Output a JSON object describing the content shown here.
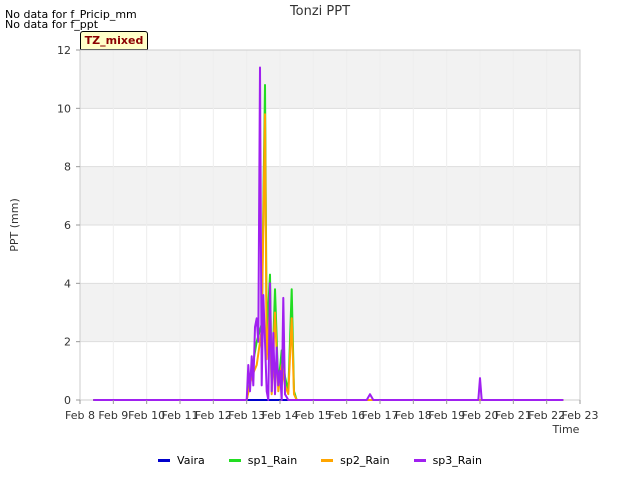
{
  "notes": [
    "No data for f_Pricip_mm",
    "No data for f_ppt"
  ],
  "tag_label": "TZ_mixed",
  "colors": {
    "Vaira": "#0000cc",
    "sp1_Rain": "#22dd22",
    "sp2_Rain": "#ffa500",
    "sp3_Rain": "#a020f0",
    "band": "#f2f2f2",
    "grid": "#dddddd"
  },
  "chart_data": {
    "type": "line",
    "title": "Tonzi PPT",
    "xlabel": "Time",
    "ylabel": "PPT (mm)",
    "x_ticks": [
      "Feb 8",
      "Feb 9",
      "Feb 10",
      "Feb 11",
      "Feb 12",
      "Feb 13",
      "Feb 14",
      "Feb 15",
      "Feb 16",
      "Feb 17",
      "Feb 18",
      "Feb 19",
      "Feb 20",
      "Feb 21",
      "Feb 22",
      "Feb 23"
    ],
    "xlim": [
      "Feb 8",
      "Feb 23"
    ],
    "y_ticks": [
      0,
      2,
      4,
      6,
      8,
      10,
      12
    ],
    "ylim": [
      0,
      12
    ],
    "legend_position": "bottom-center",
    "series": [
      {
        "name": "Vaira",
        "x": [
          8.4,
          22.5
        ],
        "y": [
          0,
          0
        ]
      },
      {
        "name": "sp1_Rain",
        "x": [
          8.4,
          13.0,
          13.15,
          13.3,
          13.45,
          13.55,
          13.6,
          13.7,
          13.75,
          13.85,
          13.95,
          14.05,
          14.15,
          14.25,
          14.35,
          14.42,
          14.5,
          14.6,
          22.5
        ],
        "y": [
          0,
          0,
          1.0,
          2.0,
          2.6,
          10.8,
          2.2,
          4.3,
          0.3,
          3.8,
          0.5,
          1.7,
          0.8,
          0.3,
          3.8,
          0.3,
          0,
          0,
          0
        ]
      },
      {
        "name": "sp2_Rain",
        "x": [
          8.4,
          13.0,
          13.15,
          13.3,
          13.45,
          13.55,
          13.6,
          13.7,
          13.75,
          13.85,
          13.95,
          14.05,
          14.15,
          14.25,
          14.35,
          14.42,
          14.5,
          22.5
        ],
        "y": [
          0,
          0,
          0.8,
          1.2,
          2.4,
          9.8,
          1.4,
          3.2,
          0.2,
          3.0,
          0.3,
          1.2,
          0.5,
          0.2,
          2.8,
          0.2,
          0,
          0
        ]
      },
      {
        "name": "sp3_Rain",
        "x": [
          8.4,
          13.0,
          13.05,
          13.1,
          13.15,
          13.2,
          13.25,
          13.3,
          13.35,
          13.4,
          13.45,
          13.5,
          13.55,
          13.6,
          13.65,
          13.7,
          13.75,
          13.8,
          13.85,
          13.9,
          13.95,
          14.0,
          14.05,
          14.1,
          14.15,
          14.2,
          14.25,
          14.3,
          14.35,
          14.4,
          14.45,
          14.5,
          16.6,
          16.7,
          16.8,
          19.95,
          20.0,
          20.05,
          22.5
        ],
        "y": [
          0,
          0,
          1.2,
          0.3,
          1.5,
          0.5,
          2.5,
          2.8,
          2.0,
          11.4,
          0.5,
          3.6,
          2.0,
          0.3,
          0,
          4.0,
          0.3,
          2.3,
          0.2,
          1.8,
          0.5,
          1.0,
          0,
          3.5,
          0.2,
          0.1,
          0,
          0,
          0,
          0,
          0,
          0,
          0,
          0.2,
          0,
          0,
          0.75,
          0,
          0
        ]
      }
    ]
  }
}
